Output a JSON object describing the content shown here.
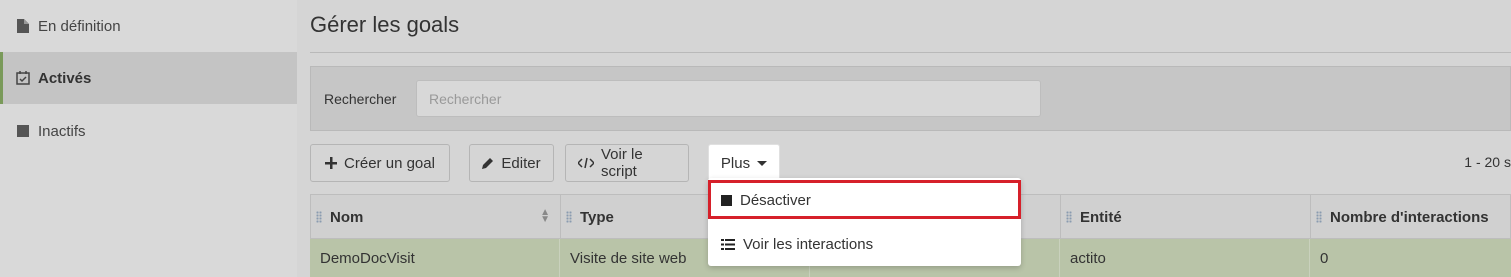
{
  "sidebar": {
    "items": [
      {
        "label": "En définition",
        "icon": "file-icon"
      },
      {
        "label": "Activés",
        "icon": "calendar-check-icon"
      },
      {
        "label": "Inactifs",
        "icon": "square-icon"
      }
    ]
  },
  "page": {
    "title": "Gérer les goals"
  },
  "search": {
    "label": "Rechercher",
    "placeholder": "Rechercher",
    "value": ""
  },
  "toolbar": {
    "create_label": "Créer un goal",
    "edit_label": "Editer",
    "script_label": "Voir le script",
    "more_label": "Plus"
  },
  "paging": {
    "text": "1 - 20 s"
  },
  "table": {
    "headers": [
      "Nom",
      "Type",
      "",
      "Entité",
      "Nombre d'interactions"
    ],
    "rows": [
      [
        "DemoDocVisit",
        "Visite de site web",
        "",
        "actito",
        "0"
      ]
    ]
  },
  "dropdown": {
    "items": [
      {
        "label": "Désactiver",
        "icon": "stop-square-icon"
      },
      {
        "label": "Voir les interactions",
        "icon": "list-icon"
      }
    ]
  },
  "colors": {
    "highlight": "#d6202a",
    "active_row": "#b9c4a8"
  }
}
